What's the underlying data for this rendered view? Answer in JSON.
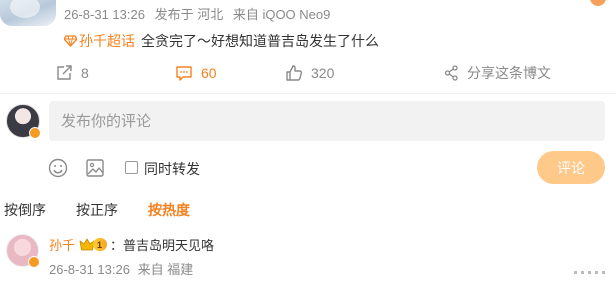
{
  "post": {
    "meta": {
      "timestamp": "26-8-31 13:26",
      "location": "发布于 河北",
      "device": "来自 iQOO Neo9"
    },
    "topic": "孙千超话",
    "content": "全贪完了～好想知道普吉岛发生了什么",
    "actions": {
      "repost_count": "8",
      "comment_count": "60",
      "like_count": "320",
      "share_label": "分享这条博文"
    }
  },
  "composer": {
    "placeholder": "发布你的评论",
    "repost_label": "同时转发",
    "submit_label": "评论"
  },
  "sort_tabs": [
    {
      "label": "按倒序",
      "active": false
    },
    {
      "label": "按正序",
      "active": false
    },
    {
      "label": "按热度",
      "active": true
    }
  ],
  "comments": [
    {
      "name": "孙千",
      "level": "1",
      "text": "：普吉岛明天见咯",
      "timestamp": "26-8-31 13:26",
      "location": "来自 福建"
    }
  ],
  "colors": {
    "accent": "#f58220",
    "submit_bg": "#ffc98a",
    "badge": "#f59a23"
  },
  "icons": [
    "repost-icon",
    "comment-icon",
    "like-icon",
    "share-icon",
    "emoji-icon",
    "image-icon",
    "crown-icon",
    "more-icon"
  ]
}
